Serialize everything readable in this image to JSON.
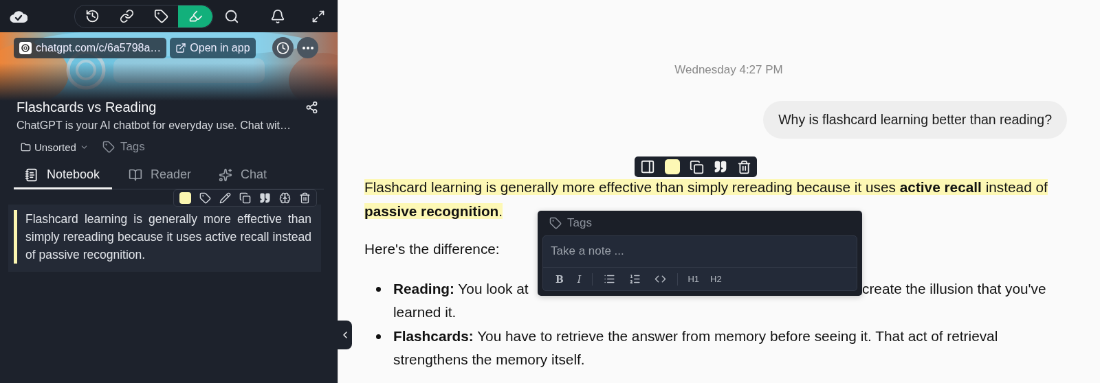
{
  "top_bar": {
    "tools": [
      {
        "kind": "history",
        "selected": false
      },
      {
        "kind": "link",
        "selected": false
      },
      {
        "kind": "tag",
        "selected": false
      },
      {
        "kind": "highlighter",
        "selected": true
      }
    ]
  },
  "source": {
    "url": "chatgpt.com/c/6a5798a…",
    "open_button": "Open in app"
  },
  "page": {
    "title": "Flashcards vs Reading",
    "description": "ChatGPT is your AI chatbot for everyday use. Chat wit…",
    "folder": "Unsorted",
    "tags_placeholder": "Tags"
  },
  "tabs": [
    {
      "label": "Notebook",
      "kind": "notebook",
      "selected": true
    },
    {
      "label": "Reader",
      "kind": "reader",
      "selected": false
    },
    {
      "label": "Chat",
      "kind": "chat",
      "selected": false
    }
  ],
  "highlight_card": {
    "color": "#fbf6b0",
    "text": "Flashcard learning is generally more effective than simply rereading because it uses active recall instead of passive recognition."
  },
  "conversation": {
    "timestamp": "Wednesday 4:27 PM",
    "user_message": "Why is flashcard learning better than reading?",
    "highlighted_paragraph": "Flashcard learning is generally more effective than simply rereading because it uses **active recall** instead of **passive recognition**.",
    "intro": "Here's the difference:",
    "bullets": [
      {
        "lines": [
          [
            "**Reading:** You look at",
            "create the illusion that you've"
          ],
          [
            "learned it."
          ]
        ]
      },
      {
        "lines": [
          [
            "**Flashcards:** You have to retrieve the answer from memory before seeing it. That act of retrieval"
          ],
          [
            "strengthens the memory itself."
          ]
        ]
      }
    ]
  },
  "highlight_toolbar": {
    "color": "#fdf8b5"
  },
  "note_popover": {
    "tags_placeholder": "Tags",
    "placeholder": "Take a note ...",
    "format_buttons": [
      {
        "kind": "bold",
        "label": "B"
      },
      {
        "kind": "italic",
        "label": "I"
      },
      {
        "kind": "bullet_list"
      },
      {
        "kind": "numbered_list"
      },
      {
        "kind": "code"
      },
      {
        "kind": "h1",
        "label": "H1"
      },
      {
        "kind": "h2",
        "label": "H2"
      }
    ]
  }
}
